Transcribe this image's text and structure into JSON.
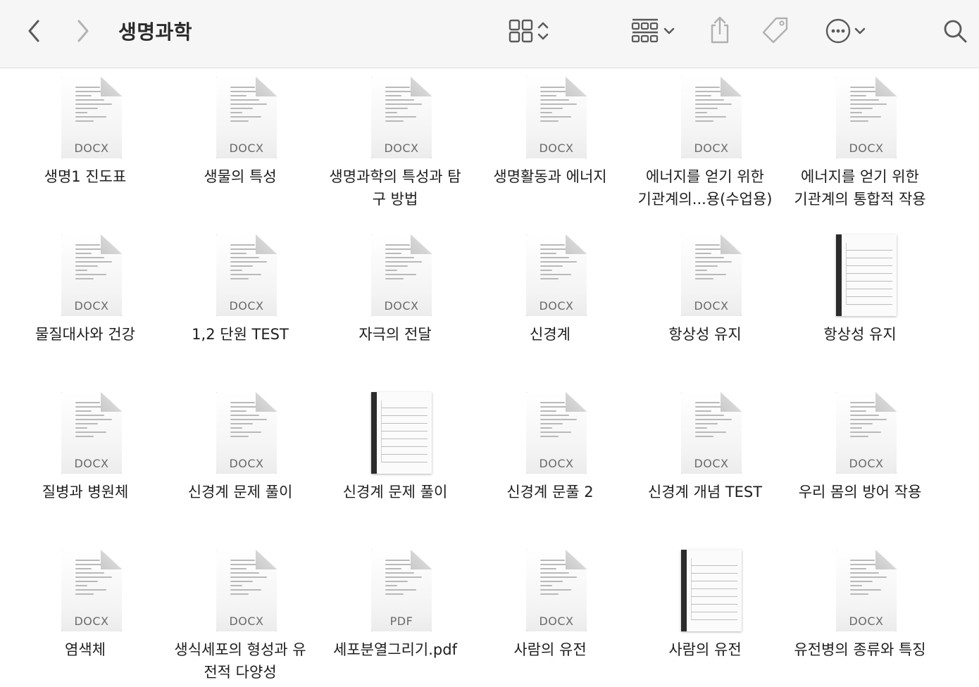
{
  "window": {
    "title": "생명과학"
  },
  "toolbar": {
    "back_icon": "chevron-left-icon",
    "forward_icon": "chevron-right-icon",
    "view_icon": "grid-view-icon",
    "group_icon": "group-by-icon",
    "share_icon": "share-icon",
    "tag_icon": "tag-icon",
    "more_icon": "more-actions-icon",
    "search_icon": "search-icon"
  },
  "files": [
    {
      "name": "생명1 진도표",
      "type": "DOCX"
    },
    {
      "name": "생물의 특성",
      "type": "DOCX"
    },
    {
      "name": "생명과학의 특성과 탐\n구 방법",
      "type": "DOCX"
    },
    {
      "name": "생명활동과 에너지",
      "type": "DOCX"
    },
    {
      "name": "에너지를 얻기 위한\n기관계의...용(수업용)",
      "type": "DOCX"
    },
    {
      "name": "에너지를 얻기 위한\n기관계의 통합적 작용",
      "type": "DOCX"
    },
    {
      "name": "물질대사와 건강",
      "type": "DOCX"
    },
    {
      "name": "1,2 단원 TEST",
      "type": "DOCX"
    },
    {
      "name": "자극의 전달",
      "type": "DOCX"
    },
    {
      "name": "신경계",
      "type": "DOCX"
    },
    {
      "name": "항상성 유지",
      "type": "DOCX"
    },
    {
      "name": "항상성 유지",
      "type": ""
    },
    {
      "name": "질병과 병원체",
      "type": "DOCX"
    },
    {
      "name": "신경계 문제 풀이",
      "type": "DOCX"
    },
    {
      "name": "신경계 문제 풀이",
      "type": ""
    },
    {
      "name": "신경계 문풀 2",
      "type": "DOCX"
    },
    {
      "name": "신경계 개념 TEST",
      "type": "DOCX"
    },
    {
      "name": "우리 몸의 방어 작용",
      "type": "DOCX"
    },
    {
      "name": "염색체",
      "type": "DOCX"
    },
    {
      "name": "생식세포의 형성과 유\n전적 다양성",
      "type": "DOCX"
    },
    {
      "name": "세포분열그리기.pdf",
      "type": "PDF"
    },
    {
      "name": "사람의 유전",
      "type": "DOCX"
    },
    {
      "name": "사람의 유전",
      "type": ""
    },
    {
      "name": "유전병의 종류와 특징",
      "type": "DOCX"
    }
  ]
}
